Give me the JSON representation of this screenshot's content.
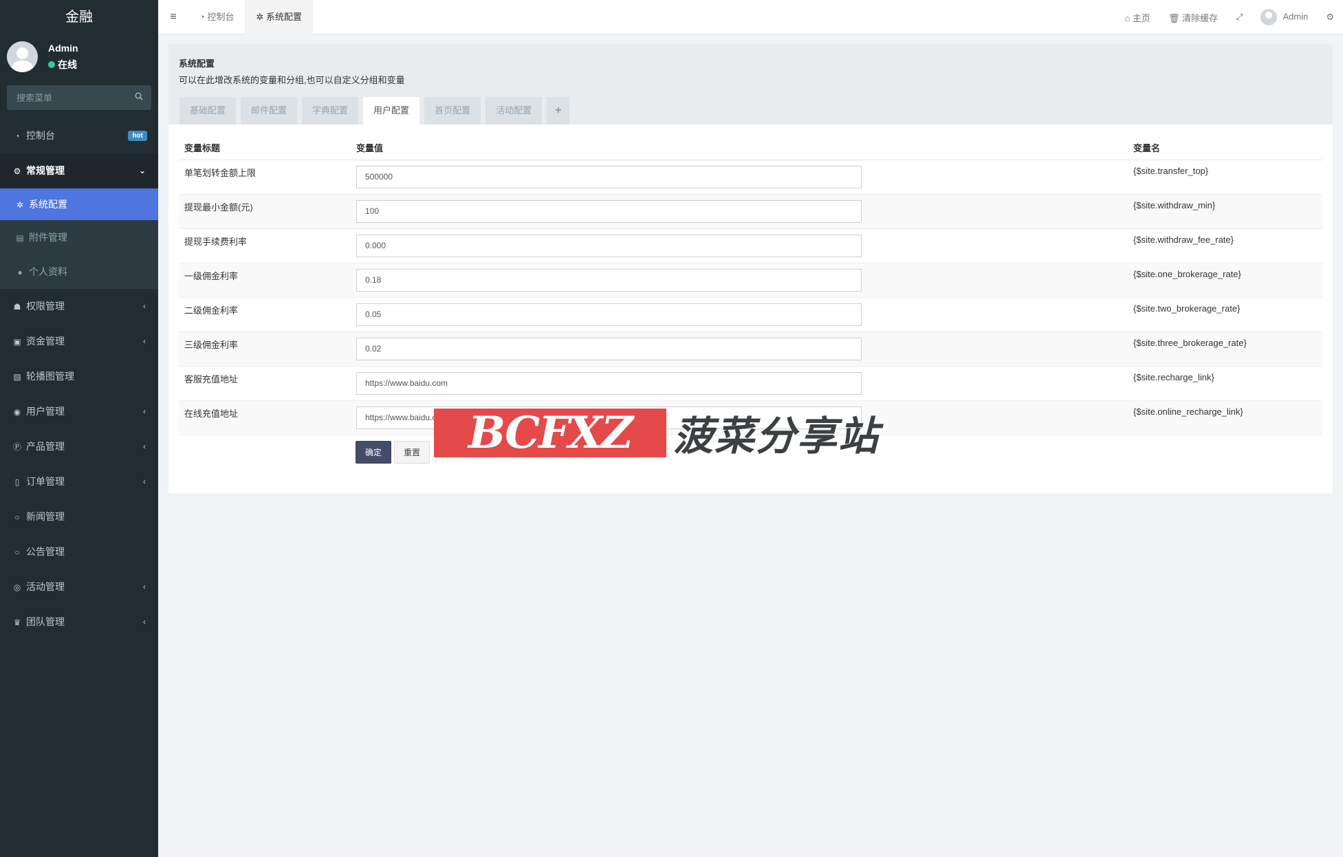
{
  "sidebar": {
    "brand": "金融",
    "user": {
      "name": "Admin",
      "status": "在线"
    },
    "search_placeholder": "搜索菜单",
    "items": [
      {
        "label": "控制台",
        "icon": "dashboard-icon",
        "badge": "hot"
      },
      {
        "label": "常规管理",
        "icon": "cogs-icon"
      },
      {
        "label": "系统配置",
        "icon": "gear-icon"
      },
      {
        "label": "附件管理",
        "icon": "file-image-icon"
      },
      {
        "label": "个人资料",
        "icon": "user-icon"
      },
      {
        "label": "权限管理",
        "icon": "group-icon"
      },
      {
        "label": "资金管理",
        "icon": "money-icon"
      },
      {
        "label": "轮播图管理",
        "icon": "image-icon"
      },
      {
        "label": "用户管理",
        "icon": "user-circle-icon"
      },
      {
        "label": "产品管理",
        "icon": "product-p-icon"
      },
      {
        "label": "订单管理",
        "icon": "order-list-icon"
      },
      {
        "label": "新闻管理",
        "icon": "circle-o-icon"
      },
      {
        "label": "公告管理",
        "icon": "circle-o-icon"
      },
      {
        "label": "活动管理",
        "icon": "play-circle-icon"
      },
      {
        "label": "团队管理",
        "icon": "trophy-icon"
      }
    ]
  },
  "header": {
    "tabs": [
      {
        "label": "控制台",
        "icon": "dashboard-icon"
      },
      {
        "label": "系统配置",
        "icon": "gear-icon"
      }
    ],
    "right": {
      "home": "主页",
      "clear_cache": "清除缓存",
      "user": "Admin"
    }
  },
  "panel": {
    "title": "系统配置",
    "description": "可以在此增改系统的变量和分组,也可以自定义分组和变量",
    "tabs": [
      "基础配置",
      "邮件配置",
      "字典配置",
      "用户配置",
      "首页配置",
      "活动配置"
    ],
    "active_tab": "用户配置",
    "columns": [
      "变量标题",
      "变量值",
      "变量名"
    ],
    "rows": [
      {
        "title": "单笔划转金额上限",
        "value": "500000",
        "name": "{$site.transfer_top}"
      },
      {
        "title": "提现最小金额(元)",
        "value": "100",
        "name": "{$site.withdraw_min}"
      },
      {
        "title": "提现手续费利率",
        "value": "0.000",
        "name": "{$site.withdraw_fee_rate}"
      },
      {
        "title": "一级佣金利率",
        "value": "0.18",
        "name": "{$site.one_brokerage_rate}"
      },
      {
        "title": "二级佣金利率",
        "value": "0.05",
        "name": "{$site.two_brokerage_rate}"
      },
      {
        "title": "三级佣金利率",
        "value": "0.02",
        "name": "{$site.three_brokerage_rate}"
      },
      {
        "title": "客服充值地址",
        "value": "https://www.baidu.com",
        "name": "{$site.recharge_link}"
      },
      {
        "title": "在线充值地址",
        "value": "https://www.baidu.com",
        "name": "{$site.online_recharge_link}"
      }
    ],
    "submit": "确定",
    "reset": "重置"
  },
  "watermark": {
    "logo": "BCFXZ",
    "text": "菠菜分享站"
  },
  "colors": {
    "sidebar": "#222d32",
    "active_menu": "#4e75e0",
    "primary_button": "#444c6b"
  }
}
